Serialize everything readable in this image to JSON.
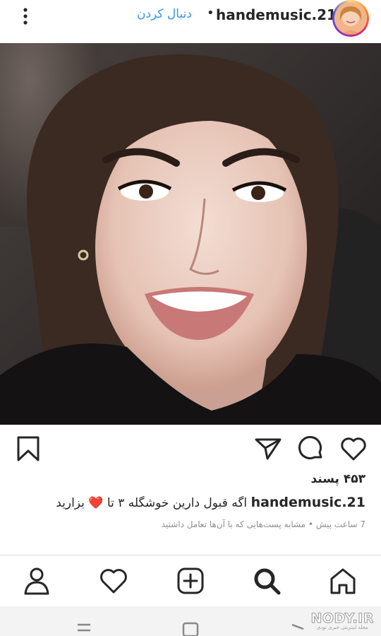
{
  "post_header": {
    "username": "hande​music.21",
    "separator": "•",
    "follow_label": "دنبال کردن",
    "more_icon": "more-vertical-icon",
    "avatar_icon": "profile-avatar"
  },
  "post": {
    "photo_icon": "selfie-photo",
    "actions": {
      "like_icon": "heart-outline-icon",
      "comment_icon": "comment-icon",
      "share_icon": "paper-plane-icon",
      "save_icon": "bookmark-icon"
    },
    "likes_text": "۴۵۳ پسند",
    "caption_user": "handemusic.21",
    "caption_text": "اگه قبول دارین خوشگله ۳ تا",
    "caption_emoji": "❤️",
    "caption_tail": "بزارید",
    "meta_text": "7 ساعت پیش • مشابه پست‌هایی که با آن‌ها تعامل داشتید"
  },
  "bottom_nav": {
    "items": [
      "home-icon",
      "search-icon",
      "add-post-icon",
      "activity-heart-icon",
      "profile-icon"
    ],
    "active": "search-icon"
  },
  "system_nav": {
    "items": [
      "back-icon",
      "home-square-icon",
      "recents-icon"
    ]
  },
  "watermark": {
    "main": "NODY.IR",
    "sub": "مجله اینترنتی خبری نودی"
  },
  "colors": {
    "follow_blue": "#3897f0",
    "text": "#262626",
    "secondary_text": "#8e8e8e",
    "heart_red": "#e0245e"
  }
}
